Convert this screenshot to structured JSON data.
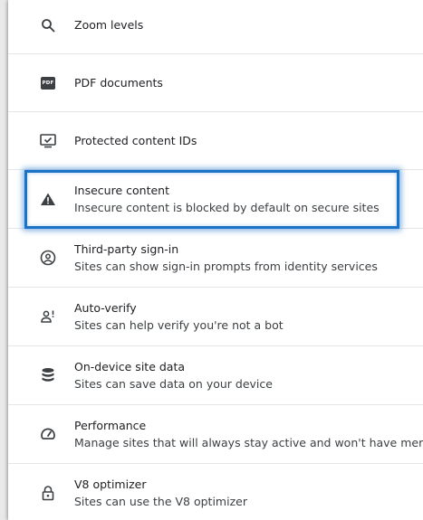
{
  "items": [
    {
      "title": "Zoom levels",
      "subtitle": "",
      "icon": "search-icon"
    },
    {
      "title": "PDF documents",
      "subtitle": "",
      "icon": "pdf-icon",
      "badge": "PDF"
    },
    {
      "title": "Protected content IDs",
      "subtitle": "",
      "icon": "monitor-check-icon"
    },
    {
      "title": "Insecure content",
      "subtitle": "Insecure content is blocked by default on secure sites",
      "icon": "warning-icon"
    },
    {
      "title": "Third-party sign-in",
      "subtitle": "Sites can show sign-in prompts from identity services",
      "icon": "account-circle-icon"
    },
    {
      "title": "Auto-verify",
      "subtitle": "Sites can help verify you're not a bot",
      "icon": "person-verify-icon"
    },
    {
      "title": "On-device site data",
      "subtitle": "Sites can save data on your device",
      "icon": "database-icon"
    },
    {
      "title": "Performance",
      "subtitle": "Manage sites that will always stay active and won't have memory",
      "icon": "speedometer-icon"
    },
    {
      "title": "V8 optimizer",
      "subtitle": "Sites can use the V8 optimizer",
      "icon": "lock-icon"
    }
  ],
  "colors": {
    "highlight": "#1a73c8",
    "text": "#202124",
    "icon": "#3c4043"
  }
}
